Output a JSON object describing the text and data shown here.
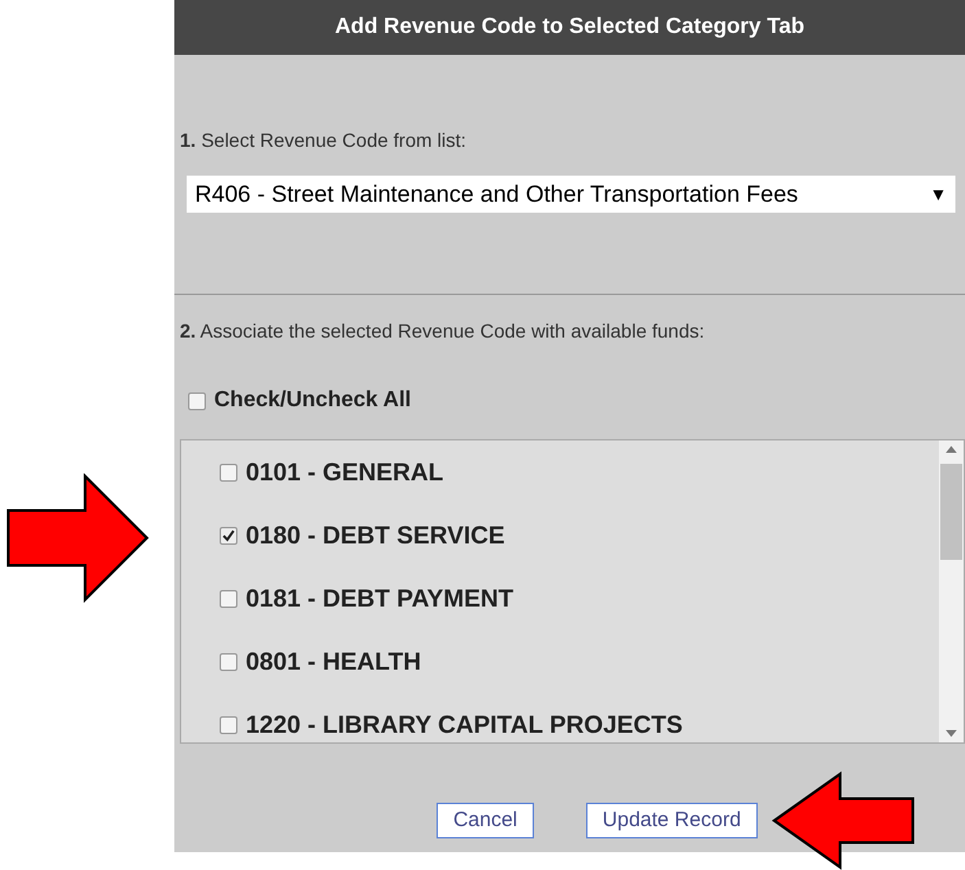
{
  "dialog": {
    "title": "Add Revenue Code to Selected Category Tab"
  },
  "step_1": {
    "label": "**1.** Select Revenue Code from list:",
    "select_value": "R406 - Street Maintenance and Other Transportation Fees",
    "caret": "▼"
  },
  "step_2": {
    "label": "**2.** Associate the selected Revenue Code with available funds:",
    "check_all": {
      "label": "Check/Uncheck All",
      "checked": false
    }
  },
  "funds": [
    {
      "label": "0101 - GENERAL",
      "checked": false
    },
    {
      "label": "0180 - DEBT SERVICE",
      "checked": true
    },
    {
      "label": "0181 - DEBT PAYMENT",
      "checked": false
    },
    {
      "label": "0801 - HEALTH",
      "checked": false
    },
    {
      "label": "1220 - LIBRARY CAPITAL PROJECTS",
      "checked": false
    }
  ],
  "buttons": [
    {
      "label": "Cancel"
    },
    {
      "label": "Update Record"
    }
  ]
}
